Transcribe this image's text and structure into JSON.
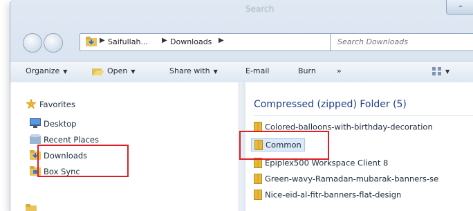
{
  "window": {
    "title": "Search"
  },
  "address": {
    "crumbs": [
      "Saifullah...",
      "Downloads"
    ],
    "search_placeholder": "Search Downloads"
  },
  "toolbar": {
    "organize": "Organize",
    "open": "Open",
    "share_with": "Share with",
    "email": "E-mail",
    "burn": "Burn",
    "more": "»"
  },
  "sidebar": {
    "favorites": "Favorites",
    "items": [
      {
        "label": "Desktop",
        "icon": "desktop-icon"
      },
      {
        "label": "Recent Places",
        "icon": "recent-places-icon"
      },
      {
        "label": "Downloads",
        "icon": "downloads-folder-icon"
      },
      {
        "label": "Box Sync",
        "icon": "box-sync-folder-icon"
      }
    ]
  },
  "files": {
    "group_header": "Compressed (zipped) Folder (5)",
    "items": [
      {
        "name": "Colored-balloons-with-birthday-decoration"
      },
      {
        "name": "Common",
        "selected": true
      },
      {
        "name": "Epiplex500 Workspace Client 8"
      },
      {
        "name": "Green-wavy-Ramadan-mubarak-banners-se"
      },
      {
        "name": "Nice-eid-al-fitr-banners-flat-design"
      }
    ]
  },
  "colors": {
    "highlight_box": "#e01d24",
    "selection": "#dbe9f8",
    "group_header": "#1e3f8c"
  }
}
